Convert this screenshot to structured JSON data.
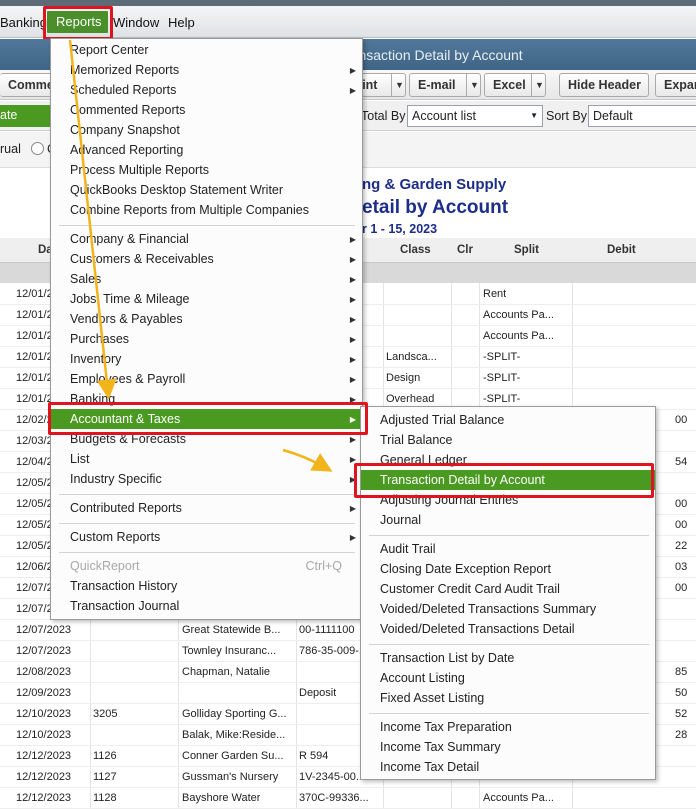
{
  "menubar": {
    "items": [
      "Banking",
      "Reports",
      "Window",
      "Help"
    ]
  },
  "window": {
    "title": "Transaction Detail by Account"
  },
  "toolbar": {
    "buttons": [
      "Comme",
      "Print",
      "E-mail",
      "Excel",
      "Hide Header",
      "Expan"
    ]
  },
  "filters": {
    "date_label": "ate",
    "total_by_label": "Total By",
    "total_by_value": "Account list",
    "sort_by_label": "Sort By",
    "sort_by_value": "Default"
  },
  "basis": {
    "accrual_label": "rual",
    "cash_label": "C"
  },
  "report": {
    "company": "ng & Garden Supply",
    "title": "etail by Account",
    "period": "r 1 - 15, 2023"
  },
  "columns": [
    "Da",
    "Class",
    "Clr",
    "Split",
    "Debit"
  ],
  "rows": [
    {
      "date": "12/01/2",
      "num": "",
      "name": "",
      "memo": "",
      "class": "",
      "split": "Rent",
      "debit": ""
    },
    {
      "date": "12/01/2",
      "num": "",
      "name": "",
      "memo": "",
      "class": "",
      "split": "Accounts Pa...",
      "debit": ""
    },
    {
      "date": "12/01/2",
      "num": "",
      "name": "",
      "memo": "",
      "class": "",
      "split": "Accounts Pa...",
      "debit": ""
    },
    {
      "date": "12/01/2",
      "num": "",
      "name": "",
      "memo": "",
      "class": "Landsca...",
      "split": "-SPLIT-",
      "debit": ""
    },
    {
      "date": "12/01/2",
      "num": "",
      "name": "",
      "memo": "",
      "class": "Design",
      "split": "-SPLIT-",
      "debit": ""
    },
    {
      "date": "12/01/2",
      "num": "",
      "name": "",
      "memo": "",
      "class": "Overhead",
      "split": "-SPLIT-",
      "debit": ""
    },
    {
      "date": "12/02/2",
      "num": "",
      "name": "",
      "memo": "",
      "class": "",
      "split": "",
      "debit": "00"
    },
    {
      "date": "12/03/2",
      "num": "",
      "name": "",
      "memo": "",
      "class": "",
      "split": "",
      "debit": ""
    },
    {
      "date": "12/04/2",
      "num": "",
      "name": "",
      "memo": "",
      "class": "",
      "split": "",
      "debit": "54"
    },
    {
      "date": "12/05/2",
      "num": "",
      "name": "",
      "memo": "",
      "class": "",
      "split": "",
      "debit": ""
    },
    {
      "date": "12/05/2",
      "num": "",
      "name": "",
      "memo": "",
      "class": "",
      "split": "",
      "debit": "00"
    },
    {
      "date": "12/05/2",
      "num": "",
      "name": "",
      "memo": "",
      "class": "",
      "split": "",
      "debit": "00"
    },
    {
      "date": "12/05/2",
      "num": "",
      "name": "",
      "memo": "",
      "class": "",
      "split": "",
      "debit": "22"
    },
    {
      "date": "12/06/2",
      "num": "",
      "name": "",
      "memo": "",
      "class": "",
      "split": "",
      "debit": "03"
    },
    {
      "date": "12/07/2",
      "num": "",
      "name": "",
      "memo": "",
      "class": "",
      "split": "",
      "debit": "00"
    },
    {
      "date": "12/07/2",
      "num": "",
      "name": "",
      "memo": "",
      "class": "",
      "split": "",
      "debit": ""
    },
    {
      "date": "12/07/2023",
      "num": "",
      "name": "Great Statewide B...",
      "memo": "00-1111100",
      "class": "",
      "split": "",
      "debit": ""
    },
    {
      "date": "12/07/2023",
      "num": "",
      "name": "Townley Insuranc...",
      "memo": "786-35-009-...",
      "class": "",
      "split": "",
      "debit": ""
    },
    {
      "date": "12/08/2023",
      "num": "",
      "name": "Chapman, Natalie",
      "memo": "",
      "class": "",
      "split": "",
      "debit": "85"
    },
    {
      "date": "12/09/2023",
      "num": "",
      "name": "",
      "memo": "Deposit",
      "class": "",
      "split": "",
      "debit": "50"
    },
    {
      "date": "12/10/2023",
      "num": "3205",
      "name": "Golliday Sporting G...",
      "memo": "",
      "class": "",
      "split": "",
      "debit": "52"
    },
    {
      "date": "12/10/2023",
      "num": "",
      "name": "Balak, Mike:Reside...",
      "memo": "",
      "class": "",
      "split": "",
      "debit": "28"
    },
    {
      "date": "12/12/2023",
      "num": "1126",
      "name": "Conner Garden Su...",
      "memo": "R 594",
      "class": "",
      "split": "",
      "debit": ""
    },
    {
      "date": "12/12/2023",
      "num": "1127",
      "name": "Gussman's Nursery",
      "memo": "1V-2345-00...",
      "class": "",
      "split": "Accounts Pa...",
      "debit": ""
    },
    {
      "date": "12/12/2023",
      "num": "1128",
      "name": "Bayshore Water",
      "memo": "370C-99336...",
      "class": "",
      "split": "Accounts Pa...",
      "debit": ""
    }
  ],
  "reports_menu": {
    "group1": [
      "Report Center",
      "Memorized Reports",
      "Scheduled Reports",
      "Commented Reports",
      "Company Snapshot",
      "Advanced Reporting",
      "Process Multiple Reports",
      "QuickBooks Desktop Statement Writer",
      "Combine Reports from Multiple Companies"
    ],
    "group2": [
      "Company & Financial",
      "Customers & Receivables",
      "Sales",
      "Jobs, Time & Mileage",
      "Vendors & Payables",
      "Purchases",
      "Inventory",
      "Employees & Payroll",
      "Banking",
      "Accountant & Taxes",
      "Budgets & Forecasts",
      "List",
      "Industry Specific"
    ],
    "group3": [
      "Contributed Reports"
    ],
    "group4": [
      "Custom Reports"
    ],
    "group5": [
      "QuickReport",
      "Transaction History",
      "Transaction Journal"
    ],
    "quickreport_shortcut": "Ctrl+Q"
  },
  "accountant_submenu": {
    "group1": [
      "Adjusted Trial Balance",
      "Trial Balance",
      "General Ledger",
      "Transaction Detail by Account",
      "Adjusting Journal Entries",
      "Journal"
    ],
    "group2": [
      "Audit Trail",
      "Closing Date Exception Report",
      "Customer Credit Card Audit Trail",
      "Voided/Deleted Transactions Summary",
      "Voided/Deleted Transactions Detail"
    ],
    "group3": [
      "Transaction List by Date",
      "Account Listing",
      "Fixed Asset Listing"
    ],
    "group4": [
      "Income Tax Preparation",
      "Income Tax Summary",
      "Income Tax Detail"
    ]
  },
  "colors": {
    "highlight": "#4a9a22",
    "annotation_red": "#e0141e",
    "annotation_arrow": "#f2b41b",
    "report_header": "#1d2e8a"
  }
}
